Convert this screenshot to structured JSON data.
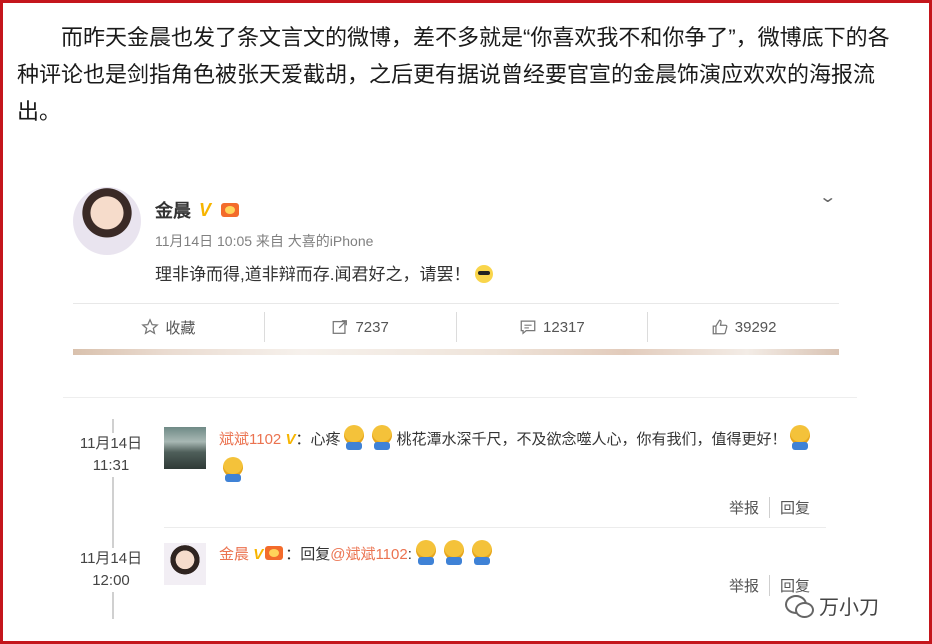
{
  "article": {
    "paragraph": "而昨天金晨也发了条文言文的微博，差不多就是“你喜欢我不和你争了”，微博底下的各种评论也是剑指角色被张天爱截胡，之后更有据说曾经要官宣的金晨饰演应欢欢的海报流出。"
  },
  "post": {
    "author": "金晨",
    "v_badge": "V",
    "meta": "11月14日 10:05 来自 大喜的iPhone",
    "text": "理非诤而得,道非辩而存.闻君好之，请罢！",
    "actions": {
      "favorite_label": "收藏",
      "repost_count": "7237",
      "comment_count": "12317",
      "like_count": "39292"
    }
  },
  "comments": [
    {
      "date": "11月14日",
      "time": "11:31",
      "user": "斌斌1102",
      "v_badge": "V",
      "text_before": "：心疼",
      "text_middle": "桃花潭水深千尺，不及欲念噬人心，你有我们，值得更好！",
      "report_label": "举报",
      "reply_label": "回复"
    },
    {
      "date": "11月14日",
      "time": "12:00",
      "user": "金晨",
      "v_badge": "V",
      "text_before": "：回复",
      "mention": "@斌斌1102",
      "text_after": ":",
      "report_label": "举报",
      "reply_label": "回复"
    }
  ],
  "watermark": {
    "text": "万小刀"
  },
  "colors": {
    "frame": "#c4161c",
    "name_orange": "#eb7350",
    "v_gold": "#f7b500"
  }
}
